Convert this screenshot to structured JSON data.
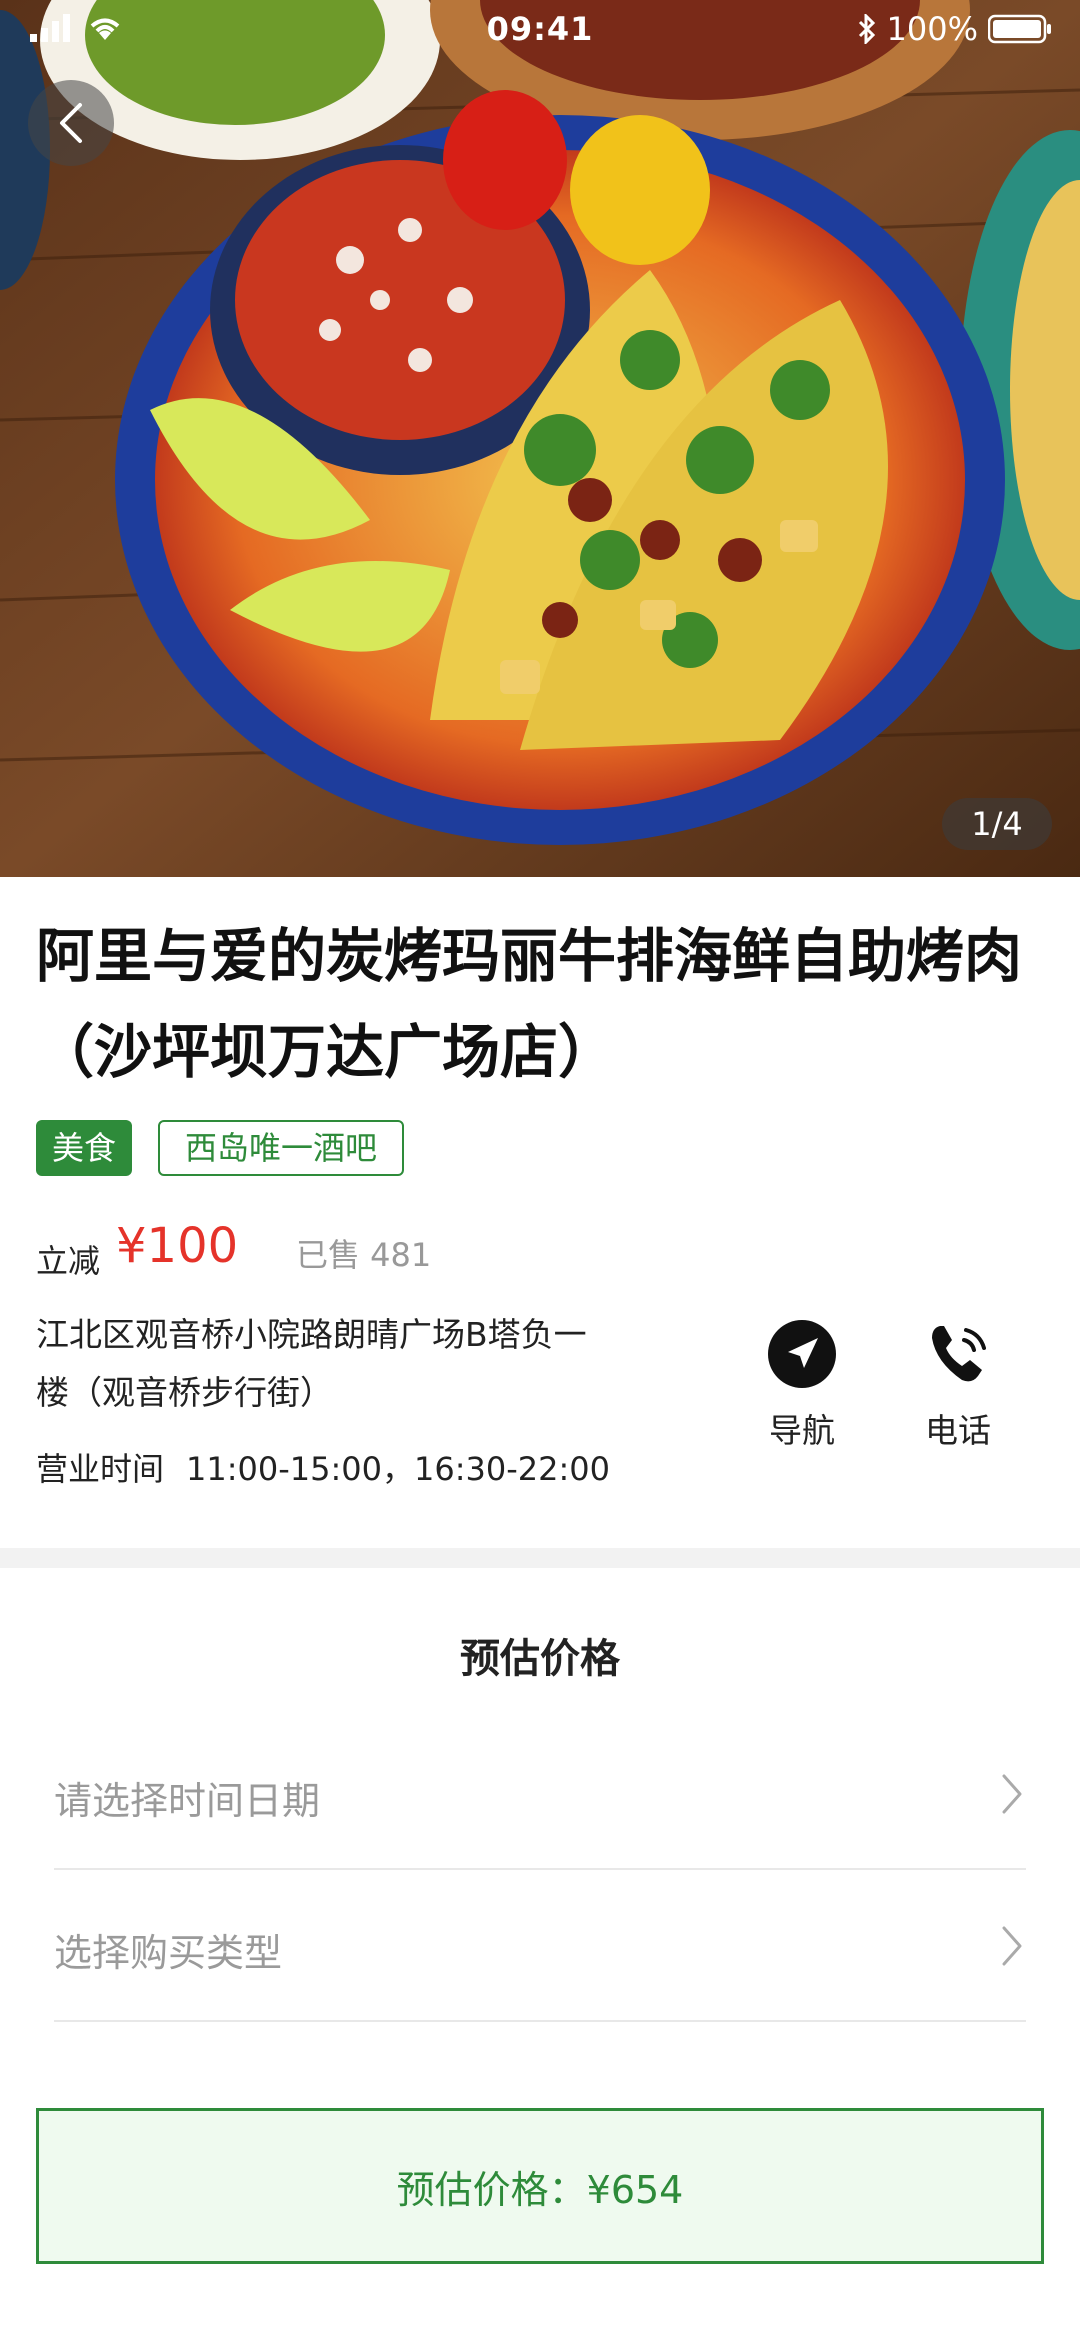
{
  "status_bar": {
    "time": "09:41",
    "battery": "100%"
  },
  "gallery": {
    "counter": "1/4"
  },
  "shop": {
    "title": "阿里与爱的炭烤玛丽牛排海鲜自助烤肉（沙坪坝万达广场店）",
    "tags": [
      "美食",
      "西岛唯一酒吧"
    ],
    "discount_label": "立减",
    "discount_amount": "¥100",
    "sold": "已售 481",
    "address": "江北区观音桥小院路朗晴广场B塔负一楼（观音桥步行街）",
    "hours_label": "营业时间",
    "hours_value": "11:00-15:00，16:30-22:00"
  },
  "actions": {
    "navigate_label": "导航",
    "call_label": "电话"
  },
  "estimate": {
    "section_title": "预估价格",
    "date_placeholder": "请选择时间日期",
    "type_placeholder": "选择购买类型",
    "total_label": "预估价格：¥654"
  },
  "icons": [
    "signal-icon",
    "wifi-icon",
    "bluetooth-icon",
    "battery-icon",
    "back-arrow-icon",
    "navigation-arrow-icon",
    "phone-icon",
    "chevron-right-icon"
  ],
  "colors": {
    "accent_green": "#2e8b3a",
    "price_red": "#e5332a",
    "estimate_bg": "#effaef"
  }
}
